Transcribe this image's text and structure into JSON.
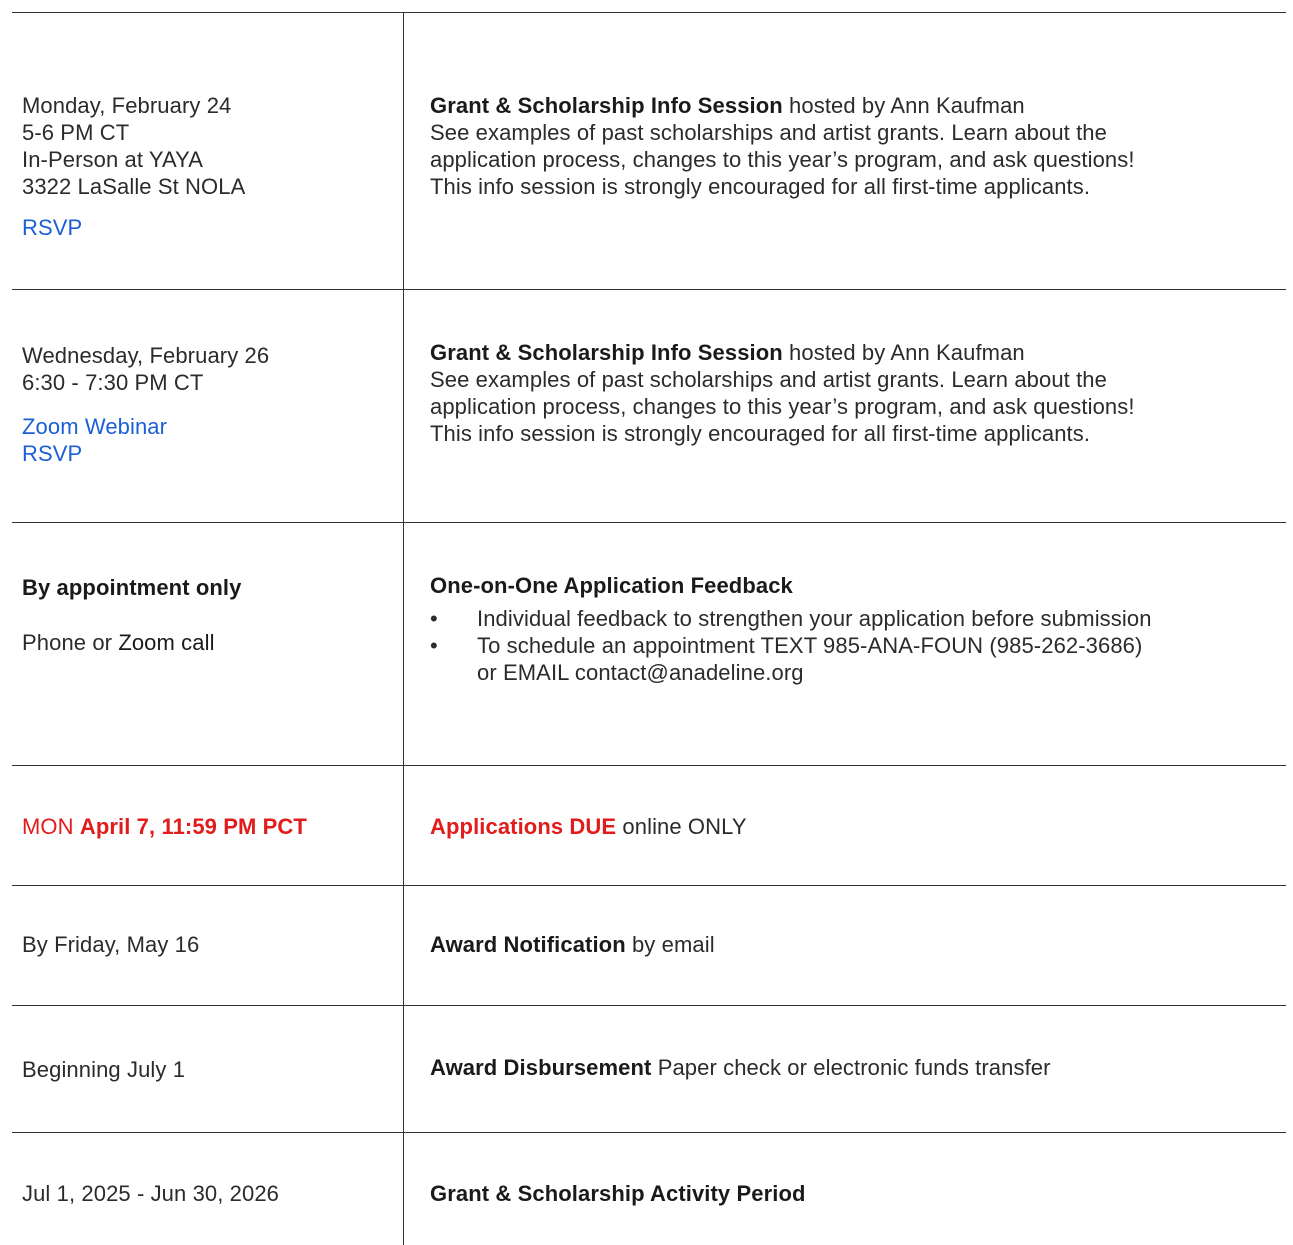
{
  "rows": [
    {
      "left": {
        "date": "Monday, February 24",
        "time": "5-6 PM CT",
        "location_line1": "In-Person at YAYA",
        "location_line2": "3322 LaSalle St NOLA",
        "rsvp": "RSVP"
      },
      "right": {
        "title": "Grant & Scholarship Info Session",
        "host": "hosted by Ann Kaufman",
        "line1": "See examples of past scholarships and artist grants. Learn about the",
        "line2": "application process, changes to this year’s program, and ask questions!",
        "line3": "This info session is strongly encouraged for all first-time applicants."
      }
    },
    {
      "left": {
        "date": "Wednesday, February 26",
        "time": "6:30 - 7:30 PM CT",
        "zoom": "Zoom Webinar",
        "rsvp": "RSVP"
      },
      "right": {
        "title": "Grant & Scholarship Info Session",
        "host": "hosted by Ann Kaufman",
        "line1": "See examples of past scholarships and artist grants. Learn about the",
        "line2": "application process, changes to this year’s program, and ask questions!",
        "line3": "This info session is strongly encouraged for all first-time applicants."
      }
    },
    {
      "left": {
        "heading": "By appointment only",
        "method_prefix": "Phone or",
        "method_suffix": "Zoom call"
      },
      "right": {
        "title": "One-on-One Application Feedback",
        "bullet_char": "•",
        "bullet1": "Individual feedback to strengthen your application before submission",
        "bullet2_line1": "To schedule an appointment TEXT 985-ANA-FOUN (985-262-3686)",
        "bullet2_line2": "or EMAIL contact@anadeline.org"
      }
    },
    {
      "left": {
        "day": "MON",
        "deadline": "April 7, 11:59 PM PCT"
      },
      "right": {
        "title": "Applications DUE",
        "suffix": "online ONLY"
      }
    },
    {
      "left": {
        "text": "By Friday, May 16"
      },
      "right": {
        "title": "Award Notification",
        "suffix": "by email"
      }
    },
    {
      "left": {
        "text": "Beginning July 1"
      },
      "right": {
        "title": "Award Disbursement",
        "suffix": "Paper check or electronic funds transfer"
      }
    },
    {
      "left": {
        "text": "Jul 1, 2025 - Jun 30, 2026"
      },
      "right": {
        "title": "Grant & Scholarship Activity Period"
      }
    }
  ],
  "colors": {
    "text": "#2b2b2b",
    "link": "#1b5fd6",
    "deadline_red": "#e21b1b",
    "rule": "#333333"
  }
}
